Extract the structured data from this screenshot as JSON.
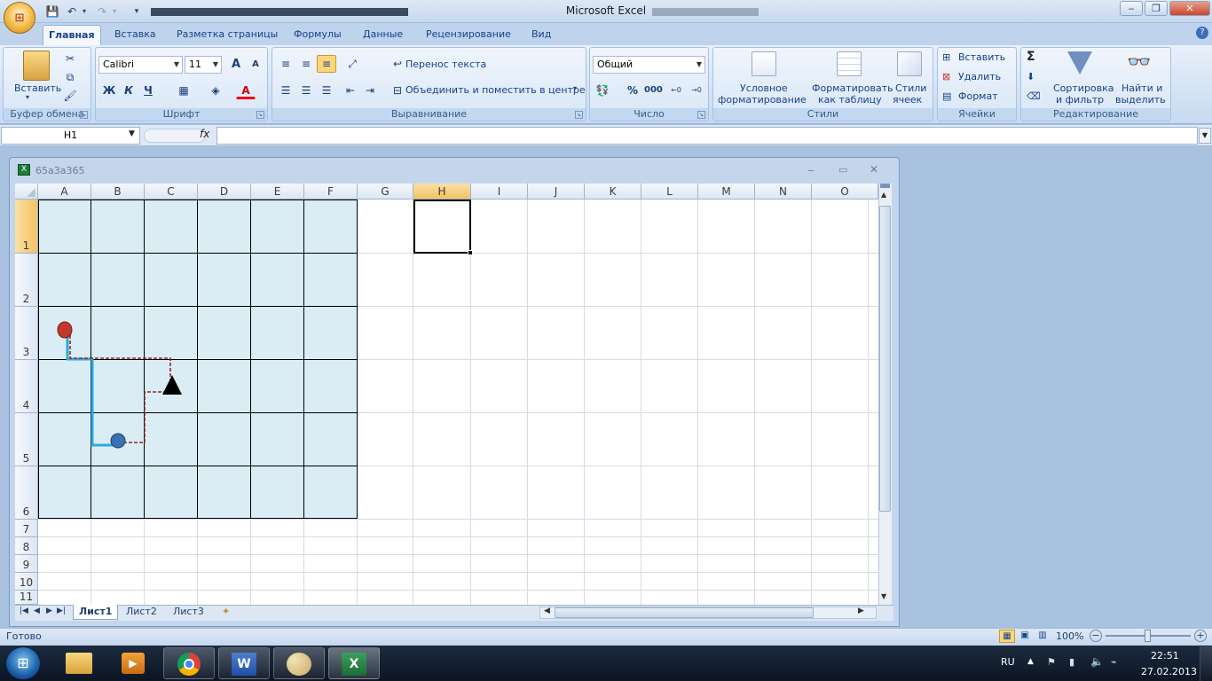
{
  "window": {
    "app_title": "Microsoft Excel"
  },
  "ribbon": {
    "tabs": [
      {
        "label": "Главная",
        "active": true
      },
      {
        "label": "Вставка"
      },
      {
        "label": "Разметка страницы"
      },
      {
        "label": "Формулы"
      },
      {
        "label": "Данные"
      },
      {
        "label": "Рецензирование"
      },
      {
        "label": "Вид"
      }
    ],
    "clipboard": {
      "title": "Буфер обмена",
      "paste": "Вставить"
    },
    "font": {
      "title": "Шрифт",
      "family": "Calibri",
      "size": "11",
      "bold": "Ж",
      "italic": "К",
      "underline": "Ч",
      "grow": "A",
      "shrink": "A"
    },
    "alignment": {
      "title": "Выравнивание",
      "wrap": "Перенос текста",
      "merge": "Объединить и поместить в центре"
    },
    "number": {
      "title": "Число",
      "format": "Общий",
      "percent": "%",
      "thousands": "000"
    },
    "styles": {
      "title": "Стили",
      "conditional_l1": "Условное",
      "conditional_l2": "форматирование",
      "table_l1": "Форматировать",
      "table_l2": "как таблицу",
      "cell_l1": "Стили",
      "cell_l2": "ячеек"
    },
    "cells": {
      "title": "Ячейки",
      "insert": "Вставить",
      "delete": "Удалить",
      "format": "Формат"
    },
    "editing": {
      "title": "Редактирование",
      "sort_l1": "Сортировка",
      "sort_l2": "и фильтр",
      "find_l1": "Найти и",
      "find_l2": "выделить"
    }
  },
  "formula_bar": {
    "name_box": "H1",
    "fx": "fx",
    "value": ""
  },
  "workbook": {
    "title": "65a3a365",
    "columns": [
      "A",
      "B",
      "C",
      "D",
      "E",
      "F",
      "G",
      "H",
      "I",
      "J",
      "K",
      "L",
      "M",
      "N",
      "O"
    ],
    "rows": [
      "1",
      "2",
      "3",
      "4",
      "5",
      "6",
      "7",
      "8",
      "9",
      "10",
      "11"
    ],
    "selected_cell": "H1"
  },
  "sheet_tabs": [
    "Лист1",
    "Лист2",
    "Лист3"
  ],
  "status": {
    "ready": "Готово",
    "zoom": "100%"
  },
  "taskbar": {
    "lang": "RU",
    "time": "22:51",
    "date": "27.02.2013"
  },
  "colors": {
    "accent": "#15428b",
    "board_fill": "#dbedf4",
    "path_blue": "#2ba9e0",
    "path_dashed": "#8b2a2a",
    "marker_red": "#c0392b",
    "marker_blue": "#3c6fb4"
  }
}
